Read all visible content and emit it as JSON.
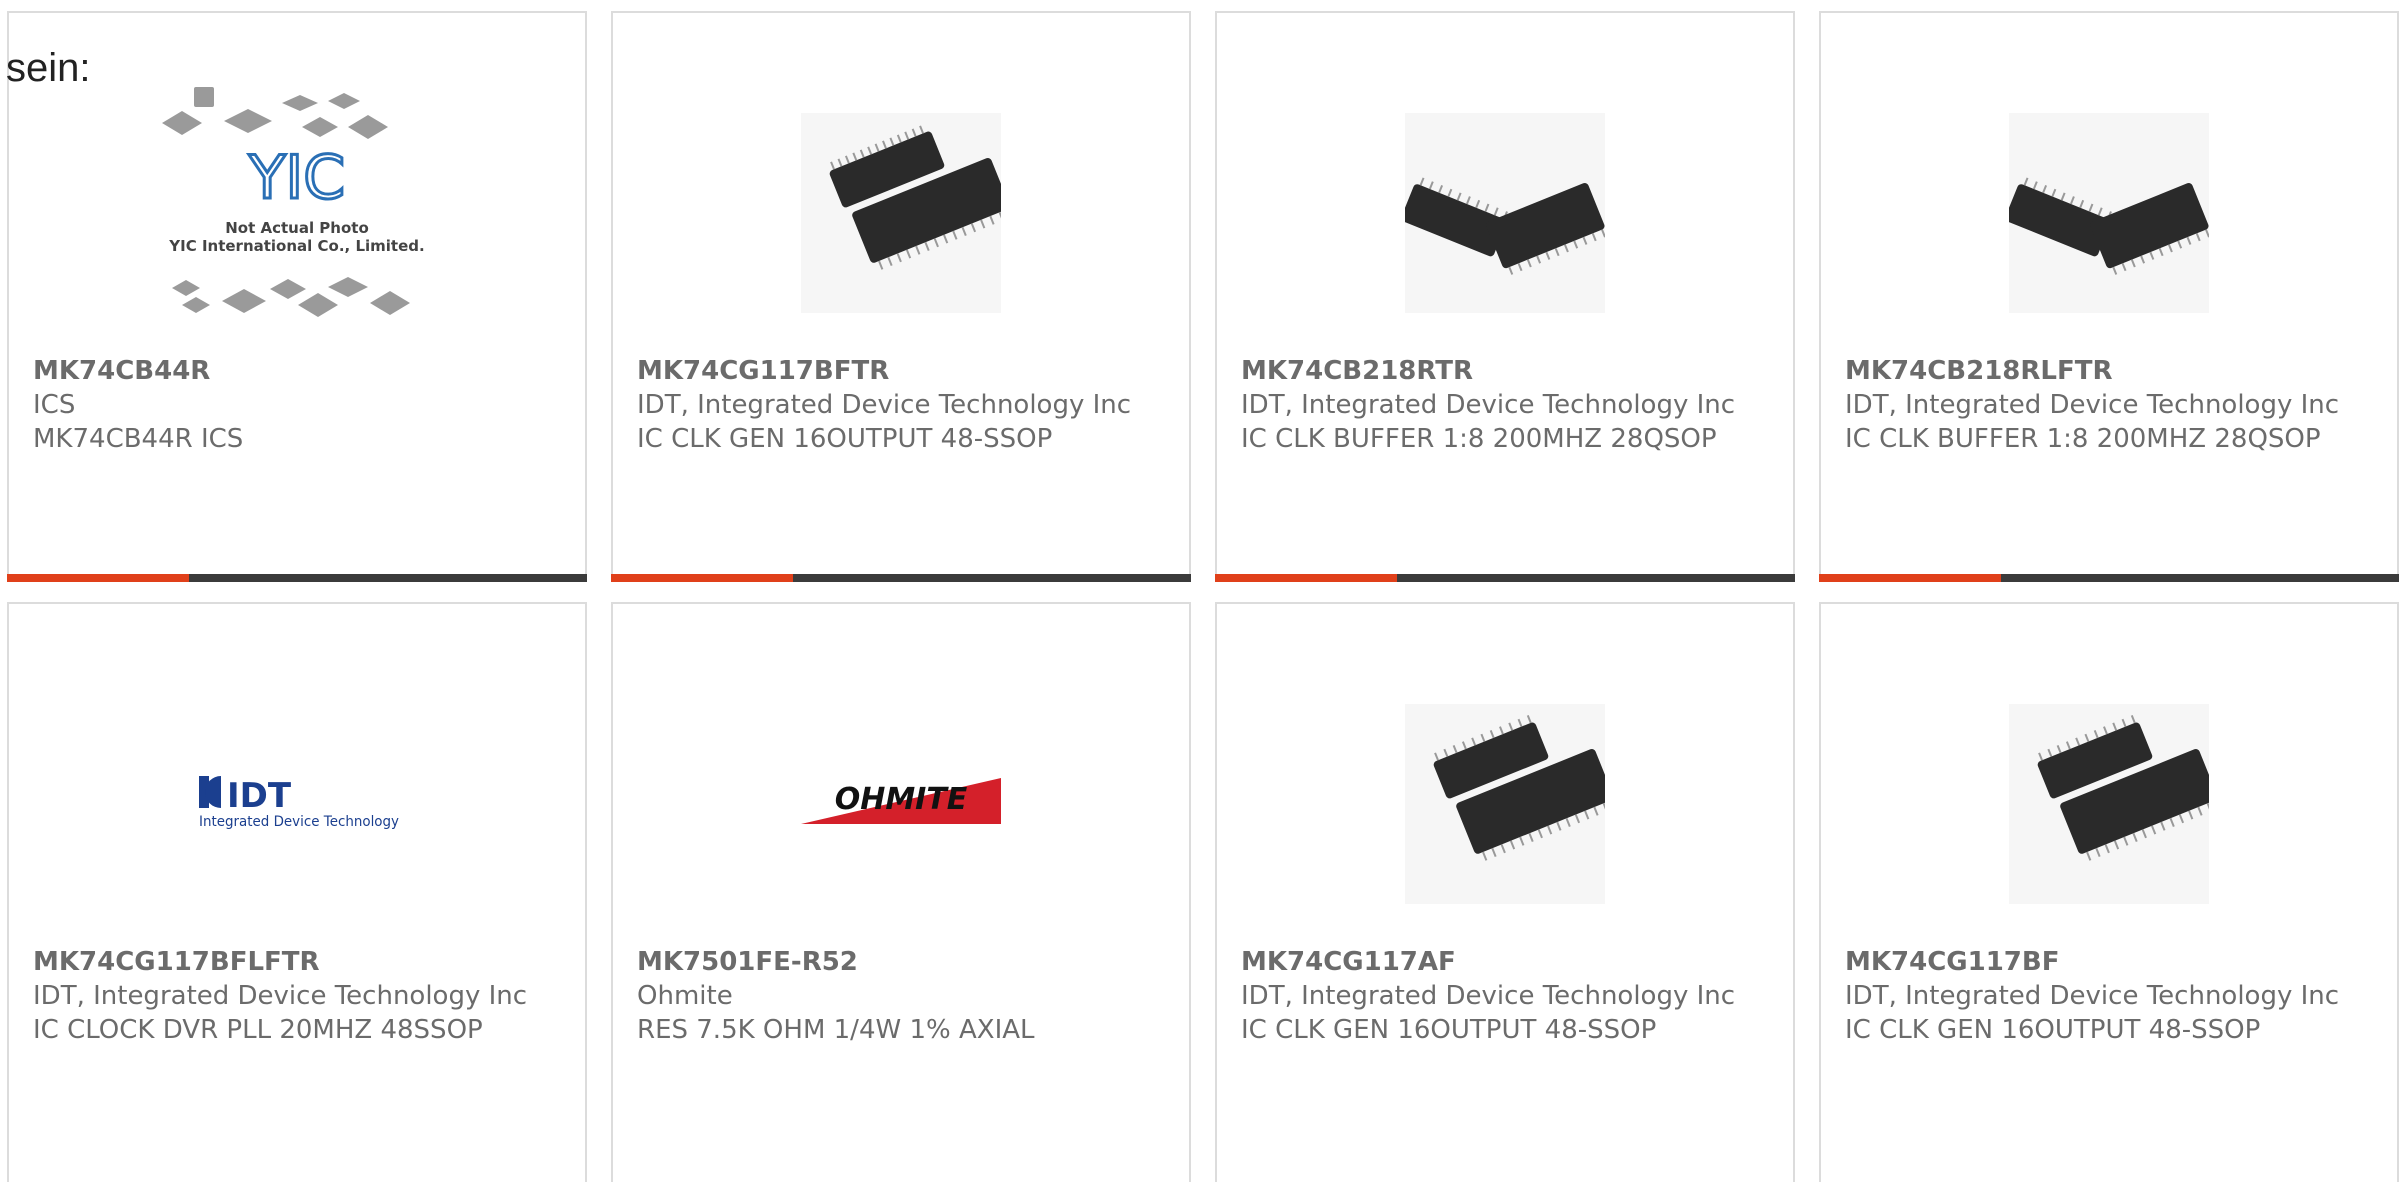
{
  "header": {
    "text": "sein:"
  },
  "accent_color": "#e0401a",
  "bar_color": "#3b3b3b",
  "products": [
    {
      "part": "MK74CB44R",
      "manufacturer": "ICS",
      "description": "MK74CB44R ICS",
      "image": "not-actual-photo",
      "image_text": [
        "Not Actual Photo",
        "YIC International Co., Limited."
      ],
      "logo_text": "YIC"
    },
    {
      "part": "MK74CG117BFTR",
      "manufacturer": "IDT, Integrated Device Technology Inc",
      "description": "IC CLK GEN 16OUTPUT 48-SSOP",
      "image": "chip-photo"
    },
    {
      "part": "MK74CB218RTR",
      "manufacturer": "IDT, Integrated Device Technology Inc",
      "description": "IC CLK BUFFER 1:8 200MHZ 28QSOP",
      "image": "chip-photo"
    },
    {
      "part": "MK74CB218RLFTR",
      "manufacturer": "IDT, Integrated Device Technology Inc",
      "description": "IC CLK BUFFER 1:8 200MHZ 28QSOP",
      "image": "chip-photo"
    },
    {
      "part": "MK74CG117BFLFTR",
      "manufacturer": "IDT, Integrated Device Technology Inc",
      "description": "IC CLOCK DVR PLL 20MHZ 48SSOP",
      "image": "idt-logo",
      "logo_text": [
        "IDT",
        "Integrated Device Technology"
      ]
    },
    {
      "part": "MK7501FE-R52",
      "manufacturer": "Ohmite",
      "description": "RES 7.5K OHM 1/4W 1% AXIAL",
      "image": "ohmite-logo",
      "logo_text": "OHMITE"
    },
    {
      "part": "MK74CG117AF",
      "manufacturer": "IDT, Integrated Device Technology Inc",
      "description": "IC CLK GEN 16OUTPUT 48-SSOP",
      "image": "chip-photo"
    },
    {
      "part": "MK74CG117BF",
      "manufacturer": "IDT, Integrated Device Technology Inc",
      "description": "IC CLK GEN 16OUTPUT 48-SSOP",
      "image": "chip-photo"
    }
  ]
}
